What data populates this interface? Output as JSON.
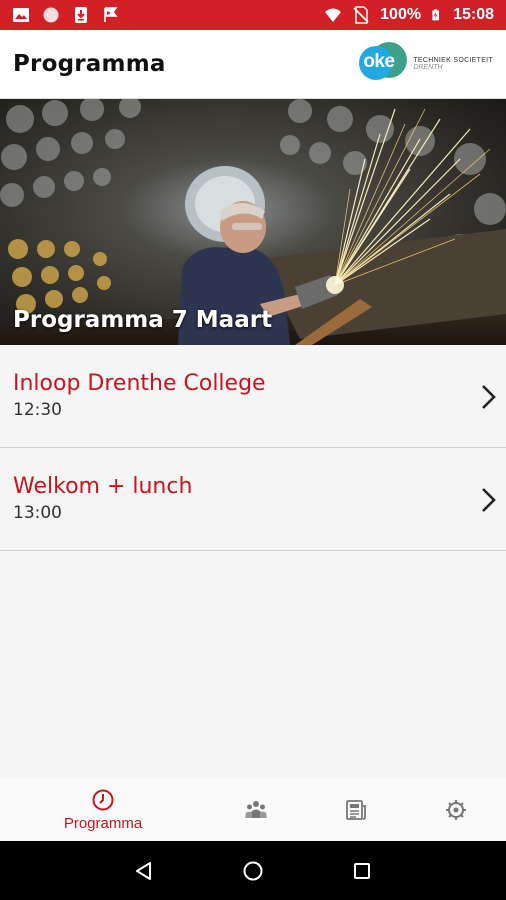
{
  "status_bar": {
    "battery": "100%",
    "time": "15:08",
    "background_color": "#d32027"
  },
  "app_bar": {
    "title": "Programma",
    "logo": {
      "word": "oke",
      "line1": "TECHNIEK SOCIETEIT",
      "line2": "DRENTH"
    }
  },
  "hero": {
    "title": "Programma 7 Maart",
    "image_icon": "worker-grinding-sparks-image"
  },
  "program_items": [
    {
      "title": "Inloop Drenthe College",
      "time": "12:30"
    },
    {
      "title": "Welkom + lunch",
      "time": "13:00"
    }
  ],
  "bottom_nav": {
    "items": [
      {
        "label": "Programma",
        "icon": "clock-icon",
        "active": true
      },
      {
        "label": "",
        "icon": "people-icon",
        "active": false
      },
      {
        "label": "",
        "icon": "newspaper-icon",
        "active": false
      },
      {
        "label": "",
        "icon": "settings-icon",
        "active": false
      }
    ]
  },
  "colors": {
    "accent": "#c8151d",
    "status_bar": "#d32027"
  }
}
